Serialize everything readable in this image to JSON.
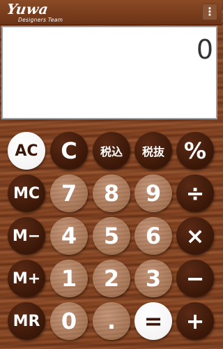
{
  "header": {
    "brand": "Yuwa",
    "subtitle": "Designers Team",
    "menu_icon": "⋮"
  },
  "display": {
    "value": "0"
  },
  "keys": {
    "ac": "AC",
    "c": "C",
    "tax_in": "税込",
    "tax_out": "税抜",
    "percent": "%",
    "mc": "MC",
    "k7": "7",
    "k8": "8",
    "k9": "9",
    "divide": "÷",
    "mminus": "M−",
    "k4": "4",
    "k5": "5",
    "k6": "6",
    "multiply": "×",
    "mplus": "M+",
    "k1": "1",
    "k2": "2",
    "k3": "3",
    "minus": "−",
    "mr": "MR",
    "k0": "0",
    "dot": ".",
    "equals": "=",
    "plus": "+"
  },
  "colors": {
    "key_dark": "#3a1708",
    "key_light": "#a3704f",
    "key_white": "#ffffff",
    "display_border": "#9aa0a3"
  }
}
